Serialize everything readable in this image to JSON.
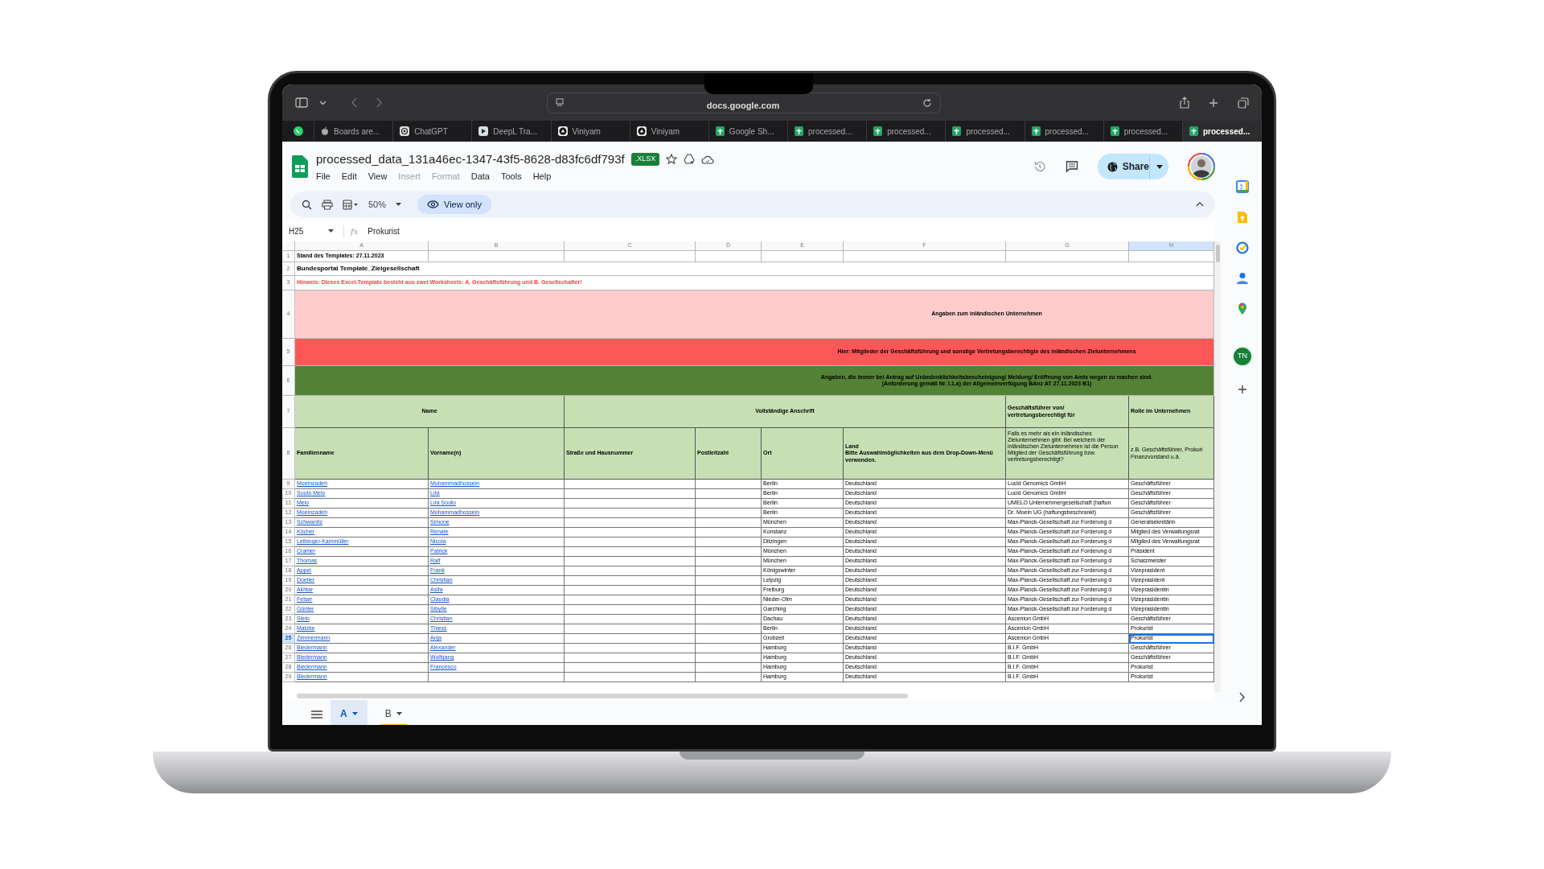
{
  "browser": {
    "address": "docs.google.com",
    "tabs": [
      {
        "kind": "whatsapp",
        "selected": false
      },
      {
        "kind": "apple",
        "label": "Boards are...",
        "selected": false
      },
      {
        "kind": "chatgpt",
        "label": "ChatGPT",
        "selected": false
      },
      {
        "kind": "deepl",
        "label": "DeepL Tra...",
        "selected": false
      },
      {
        "kind": "viniyam",
        "label": "Viniyam",
        "selected": false
      },
      {
        "kind": "viniyam",
        "label": "Viniyam",
        "selected": false
      },
      {
        "kind": "sheets",
        "label": "Google Sh...",
        "selected": false
      },
      {
        "kind": "sheets",
        "label": "processed...",
        "selected": false
      },
      {
        "kind": "sheets",
        "label": "processed...",
        "selected": false
      },
      {
        "kind": "sheets",
        "label": "processed...",
        "selected": false
      },
      {
        "kind": "sheets",
        "label": "processed...",
        "selected": false
      },
      {
        "kind": "sheets",
        "label": "processed...",
        "selected": false
      },
      {
        "kind": "sheets",
        "label": "processed...",
        "selected": true
      }
    ]
  },
  "document": {
    "title": "processed_data_131a46ec-1347-43f5-8628-d83fc6df793f",
    "badge": ".XLSX",
    "share": "Share",
    "menu": [
      {
        "label": "File",
        "disabled": false
      },
      {
        "label": "Edit",
        "disabled": false
      },
      {
        "label": "View",
        "disabled": false
      },
      {
        "label": "Insert",
        "disabled": true
      },
      {
        "label": "Format",
        "disabled": true
      },
      {
        "label": "Data",
        "disabled": false
      },
      {
        "label": "Tools",
        "disabled": false
      },
      {
        "label": "Help",
        "disabled": false
      }
    ]
  },
  "toolbar": {
    "zoom": "50%",
    "mode": "View only"
  },
  "formula_bar": {
    "cell": "H25",
    "fx": "fx",
    "value": "Prokurist"
  },
  "sheet": {
    "columns": [
      {
        "label": "A",
        "selected": false
      },
      {
        "label": "B",
        "selected": false
      },
      {
        "label": "C",
        "selected": false
      },
      {
        "label": "D",
        "selected": false
      },
      {
        "label": "E",
        "selected": false
      },
      {
        "label": "F",
        "selected": false
      },
      {
        "label": "G",
        "selected": false
      },
      {
        "label": "H",
        "selected": true
      }
    ],
    "title_rows": [
      {
        "number": "1",
        "kind": "note",
        "text": "Stand des Templates: 27.11.2023"
      },
      {
        "number": "2",
        "kind": "title",
        "text": "Bundesportal Template_Zielgesellschaft"
      },
      {
        "number": "3",
        "kind": "warning",
        "text": "Hinweis: Dieses Excel-Template besteht aus zwei Worksheets: A. Geschäftsführung und B. Gesellschafter!"
      },
      {
        "number": "4",
        "kind": "pink",
        "text": "Angaben  zum inländischen Unternehmen"
      },
      {
        "number": "5",
        "kind": "red",
        "text": "Hier: Mitglieder der Geschäftsführung und sonstige Vertretungsberechtigte des inländischen Zielunternehmens"
      },
      {
        "number": "6",
        "kind": "green",
        "text": "Angaben, die immer bei Antrag auf Unbedenklichkeitsbescheinigung/ Meldung/ Eröffnung von Amts wegen zu machen sind.\n(Anforderung gemäß Nr. I.1.a) der Allgemeinverfügung BAnz AT 27.11.2023 B1)"
      }
    ],
    "group_row": {
      "number": "7",
      "groups": [
        "Name",
        "Vollständige Anschrift",
        "Geschäftsführer von/\nvertretungsberechtigt für",
        "Rolle im Unternehmen"
      ]
    },
    "header_row": {
      "number": "8",
      "headers": [
        "Familienname",
        "Vorname(n)",
        "Straße und Hausnummer",
        "Postleitzahl",
        "Ort",
        "Land\nBitte Auswahlmöglichkeiten aus dem Drop-Down-Menü verwenden.",
        "Falls es mehr als ein inländisches Zielunternehmen gibt: Bei welchem der inländischen Zielunternehmen ist die Person Mitglied der Geschäftsführung bzw. vertretungsberechtigt?",
        "z.B. Geschäftsführer, Prokuri\nFinanzvorstand u.ä."
      ]
    },
    "rows": [
      {
        "number": "9",
        "family": "Moeinzadeh",
        "first": "Mohammadhossein",
        "city": "Berlin",
        "country": "Deutschland",
        "company": "Lucid Genomics GmbH",
        "role": "Geschäftsführer",
        "selected": false
      },
      {
        "number": "10",
        "family": "Souto Melo",
        "first": "Lira",
        "city": "Berlin",
        "country": "Deutschland",
        "company": "Lucid Genomics GmbH",
        "role": "Geschäftsführer",
        "selected": false
      },
      {
        "number": "11",
        "family": "Melo",
        "first": "Lira Souto",
        "city": "Berlin",
        "country": "Deutschland",
        "company": "UMELO Unternehmergesellschaft (haftun",
        "role": "Geschäftsführer",
        "selected": false
      },
      {
        "number": "12",
        "family": "Moeinzadeh",
        "first": "Mohammadhossein",
        "city": "Berlin",
        "country": "Deutschland",
        "company": "Dr. Moein UG (haftungsbeschrankt)",
        "role": "Geschäftsführer",
        "selected": false
      },
      {
        "number": "13",
        "family": "Schwanitz",
        "first": "Simone",
        "city": "München",
        "country": "Deutschland",
        "company": "Max-Planck-Gesellschaft zur Forderung d",
        "role": "Generalsekretärin",
        "selected": false
      },
      {
        "number": "14",
        "family": "Köcher",
        "first": "Renate",
        "city": "Konstanz",
        "country": "Deutschland",
        "company": "Max-Planck-Gesellschaft zur Forderung d",
        "role": "Mitglied des Verwaltungsrat",
        "selected": false
      },
      {
        "number": "15",
        "family": "Leibinger-Kammüller",
        "first": "Nicola",
        "city": "Ditzingen",
        "country": "Deutschland",
        "company": "Max-Planck-Gesellschaft zur Forderung d",
        "role": "Mitglied des Verwaltungsrat",
        "selected": false
      },
      {
        "number": "16",
        "family": "Cramer",
        "first": "Patrick",
        "city": "München",
        "country": "Deutschland",
        "company": "Max-Planck-Gesellschaft zur Forderung d",
        "role": "Präsident",
        "selected": false
      },
      {
        "number": "17",
        "family": "Thomas",
        "first": "Ralf",
        "city": "München",
        "country": "Deutschland",
        "company": "Max-Planck-Gesellschaft zur Forderung d",
        "role": "Schatzmeister",
        "selected": false
      },
      {
        "number": "18",
        "family": "Appel",
        "first": "Frank",
        "city": "Königswinter",
        "country": "Deutschland",
        "company": "Max-Planck-Gesellschaft zur Forderung d",
        "role": "Vizeprasident",
        "selected": false
      },
      {
        "number": "19",
        "family": "Doeller",
        "first": "Christian",
        "city": "Leipzig",
        "country": "Deutschland",
        "company": "Max-Planck-Gesellschaft zur Forderung d",
        "role": "Vizeprasident",
        "selected": false
      },
      {
        "number": "20",
        "family": "Akhtar",
        "first": "Asifa",
        "city": "Freiburg",
        "country": "Deutschland",
        "company": "Max-Planck-Gesellschaft zur Forderung d",
        "role": "Vizeprasidentin",
        "selected": false
      },
      {
        "number": "21",
        "family": "Felser",
        "first": "Claudia",
        "city": "Nieder-Olm",
        "country": "Deutschland",
        "company": "Max-Planck-Gesellschaft zur Forderung d",
        "role": "Vizeprasidentin",
        "selected": false
      },
      {
        "number": "22",
        "family": "Günter",
        "first": "Sibylle",
        "city": "Garching",
        "country": "Deutschland",
        "company": "Max-Planck-Gesellschaft zur Forderung d",
        "role": "Vizeprasidentin",
        "selected": false
      },
      {
        "number": "23",
        "family": "Stein",
        "first": "Christian",
        "city": "Dachau",
        "country": "Deutschland",
        "company": "Ascenion GmbH",
        "role": "Geschäftsführer",
        "selected": false
      },
      {
        "number": "24",
        "family": "Matzke",
        "first": "Thiess",
        "city": "Berlin",
        "country": "Deutschland",
        "company": "Ascenion GmbH",
        "role": "Prokurist",
        "selected": false
      },
      {
        "number": "25",
        "family": "Zimmermann",
        "first": "Anja",
        "city": "Grobzell",
        "country": "Deutschland",
        "company": "Ascenion GmbH",
        "role": "Prokurist",
        "selected": true
      },
      {
        "number": "26",
        "family": "Biedermann",
        "first": "Alexander",
        "city": "Hamburg",
        "country": "Deutschland",
        "company": "B.I.F. GmbH",
        "role": "Geschäftsführer",
        "selected": false
      },
      {
        "number": "27",
        "family": "Biedermann",
        "first": "Wolfgang",
        "city": "Hamburg",
        "country": "Deutschland",
        "company": "B.I.F. GmbH",
        "role": "Geschäftsführer",
        "selected": false
      },
      {
        "number": "28",
        "family": "Biedermann",
        "first": "Francesco",
        "city": "Hamburg",
        "country": "Deutschland",
        "company": "B.I.F. GmbH",
        "role": "Prokurist",
        "selected": false
      },
      {
        "number": "29",
        "family": "Biedermann",
        "city": "Hamburg",
        "country": "Deutschland",
        "company": "B.I.F. GmbH",
        "role": "Prokurist",
        "selected": false
      }
    ]
  },
  "sheet_tabs": [
    {
      "label": "A",
      "selected": true
    },
    {
      "label": "B",
      "selected": false,
      "color": "#fbbc04"
    }
  ],
  "side_panel": {
    "avatar": "TN"
  }
}
